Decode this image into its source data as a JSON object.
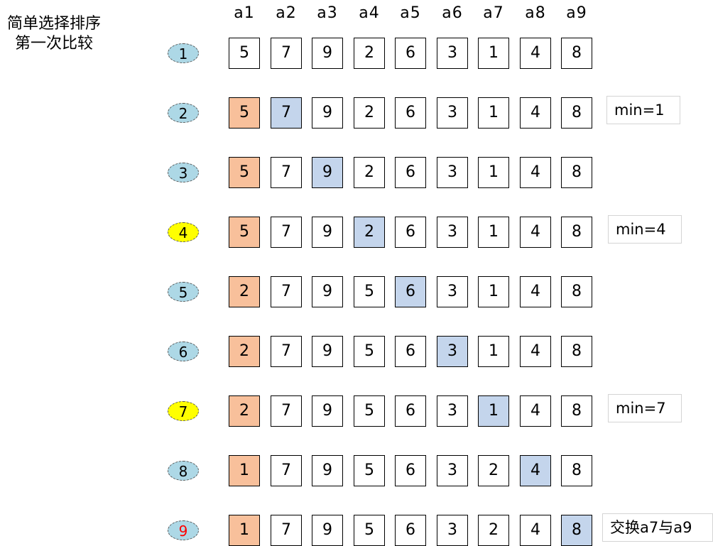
{
  "title": {
    "line1": "简单选择排序",
    "line2": "第一次比较"
  },
  "headers": [
    "a1",
    "a2",
    "a3",
    "a4",
    "a5",
    "a6",
    "a7",
    "a8",
    "a9"
  ],
  "colors": {
    "current_min": "#f8c09b",
    "comparing": "#c4d5ec",
    "step_default": "#add8e6",
    "step_highlight": "#ffff00",
    "step_text_red": "#ff0000"
  },
  "rows": [
    {
      "step": "1",
      "step_style": "normal",
      "values": [
        "5",
        "7",
        "9",
        "2",
        "6",
        "3",
        "1",
        "4",
        "8"
      ],
      "min_index": null,
      "compare_index": null,
      "note": ""
    },
    {
      "step": "2",
      "step_style": "normal",
      "values": [
        "5",
        "7",
        "9",
        "2",
        "6",
        "3",
        "1",
        "4",
        "8"
      ],
      "min_index": 0,
      "compare_index": 1,
      "note": "min=1"
    },
    {
      "step": "3",
      "step_style": "normal",
      "values": [
        "5",
        "7",
        "9",
        "2",
        "6",
        "3",
        "1",
        "4",
        "8"
      ],
      "min_index": 0,
      "compare_index": 2,
      "note": ""
    },
    {
      "step": "4",
      "step_style": "highlight",
      "values": [
        "5",
        "7",
        "9",
        "2",
        "6",
        "3",
        "1",
        "4",
        "8"
      ],
      "min_index": 0,
      "compare_index": 3,
      "note": "min=4"
    },
    {
      "step": "5",
      "step_style": "normal",
      "values": [
        "2",
        "7",
        "9",
        "5",
        "6",
        "3",
        "1",
        "4",
        "8"
      ],
      "min_index": 0,
      "compare_index": 4,
      "note": ""
    },
    {
      "step": "6",
      "step_style": "normal",
      "values": [
        "2",
        "7",
        "9",
        "5",
        "6",
        "3",
        "1",
        "4",
        "8"
      ],
      "min_index": 0,
      "compare_index": 5,
      "note": ""
    },
    {
      "step": "7",
      "step_style": "highlight",
      "values": [
        "2",
        "7",
        "9",
        "5",
        "6",
        "3",
        "1",
        "4",
        "8"
      ],
      "min_index": 0,
      "compare_index": 6,
      "note": "min=7"
    },
    {
      "step": "8",
      "step_style": "normal",
      "values": [
        "1",
        "7",
        "9",
        "5",
        "6",
        "3",
        "2",
        "4",
        "8"
      ],
      "min_index": 0,
      "compare_index": 7,
      "note": ""
    },
    {
      "step": "9",
      "step_style": "red",
      "values": [
        "1",
        "7",
        "9",
        "5",
        "6",
        "3",
        "2",
        "4",
        "8"
      ],
      "min_index": 0,
      "compare_index": 8,
      "note": "交换a7与a9"
    }
  ]
}
